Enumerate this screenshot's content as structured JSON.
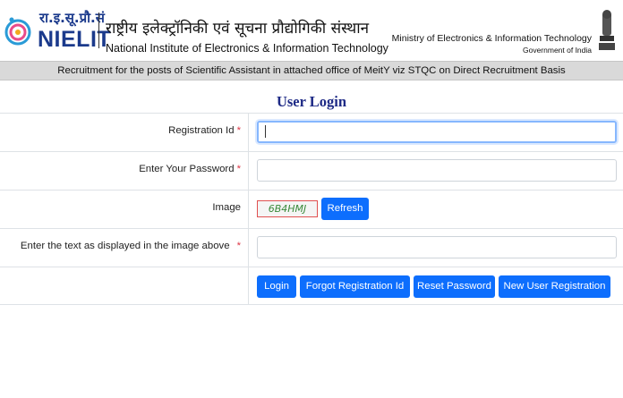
{
  "header": {
    "logo_hindi": "रा.इ.सू.प्रौ.सं",
    "logo_word": "NIELIT",
    "institute_hindi": "राष्ट्रीय इलेक्ट्रॉनिकी एवं सूचना प्रौद्योगिकी संस्थान",
    "institute_english": "National Institute of Electronics & Information Technology",
    "ministry": "Ministry of Electronics & Information Technology",
    "government": "Government of India"
  },
  "notice": "Recruitment for the posts of Scientific Assistant in attached office of MeitY viz STQC on Direct Recruitment Basis",
  "title": "User Login",
  "form": {
    "registration_label": "Registration Id",
    "password_label": "Enter Your Password",
    "image_label": "Image",
    "captcha_text": "6B4HMJ",
    "refresh_label": "Refresh",
    "captcha_input_label": "Enter the text as displayed in the image above",
    "required_mark": "*",
    "registration_value": "",
    "password_value": "",
    "captcha_value": ""
  },
  "buttons": {
    "login": "Login",
    "forgot": "Forgot Registration Id",
    "reset": "Reset Password",
    "new_user": "New User Registration"
  },
  "colors": {
    "primary_button": "#0d6efd",
    "title": "#1e2a86",
    "required": "#dc3545",
    "notice_bg": "#d9d9d9"
  }
}
